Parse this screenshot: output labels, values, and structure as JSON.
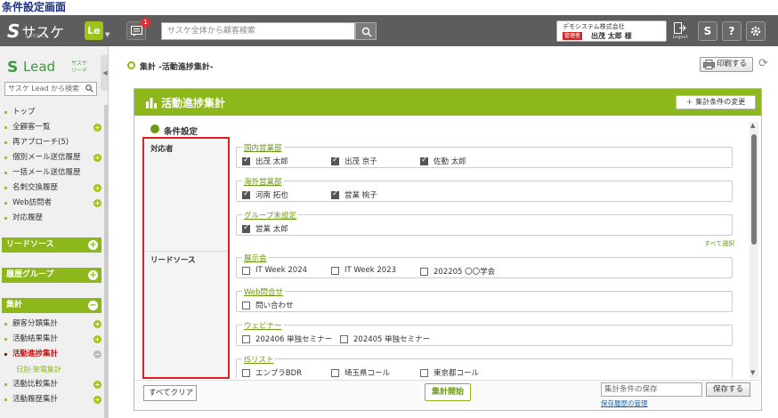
{
  "caption": "条件設定画面",
  "topbar": {
    "logo": "サスケ",
    "logo_sub": "SASUKE",
    "le_badge": "Le",
    "notification_count": "1",
    "search_placeholder": "サスケ全体から顧客検索",
    "company": "デモシステム株式会社",
    "admin_tag": "管理者",
    "user_name": "出茂 太郎 様",
    "logout_label": "Logout",
    "btn_s": "S",
    "btn_help": "?"
  },
  "sidebar": {
    "lead_logo": "Lead",
    "lead_sub": "サスケ\nリード",
    "search_placeholder": "サスケ Lead から検索",
    "items": [
      {
        "label": "トップ",
        "plus": false
      },
      {
        "label": "全顧客一覧",
        "plus": true
      },
      {
        "label": "再アプローチ(5)",
        "plus": false
      },
      {
        "label": "個別メール送信履歴",
        "plus": true
      },
      {
        "label": "一括メール送信履歴",
        "plus": false
      },
      {
        "label": "名刺交換履歴",
        "plus": true
      },
      {
        "label": "Web訪問者",
        "plus": true
      },
      {
        "label": "対応履歴",
        "plus": false
      }
    ],
    "sections": [
      "リードソース",
      "履歴グループ",
      "集計"
    ],
    "agg_items": [
      {
        "label": "顧客分類集計",
        "plus": true
      },
      {
        "label": "活動結果集計",
        "plus": true
      },
      {
        "label": "活動進捗集計",
        "plus": true,
        "active": true
      },
      {
        "label": "日別-架電集計",
        "sub": true
      },
      {
        "label": "活動比較集計",
        "plus": true
      },
      {
        "label": "活動履歴集計",
        "plus": true
      }
    ]
  },
  "breadcrumb": "集計 -活動進捗集計-",
  "print_label": "印刷する",
  "panel": {
    "title": "活動進捗集計",
    "cond_change": "＋ 集計条件の変更",
    "cond_title": "条件設定",
    "row_labels": [
      "対応者",
      "リードソース"
    ],
    "groups": [
      {
        "name": "国内営業部",
        "items": [
          {
            "label": "出茂 太郎",
            "checked": true
          },
          {
            "label": "出茂 京子",
            "checked": true
          },
          {
            "label": "佐勤 太郎",
            "checked": true
          }
        ]
      },
      {
        "name": "海外営業部",
        "items": [
          {
            "label": "河南 拓也",
            "checked": true
          },
          {
            "label": "営業 桃子",
            "checked": true
          }
        ]
      },
      {
        "name": "グループ未設定",
        "items": [
          {
            "label": "営業 太郎",
            "checked": true
          }
        ]
      },
      {
        "name": "展示会",
        "items": [
          {
            "label": "IT Week 2024",
            "checked": false
          },
          {
            "label": "IT Week 2023",
            "checked": false
          },
          {
            "label": "202205 〇〇学会",
            "checked": false
          }
        ]
      },
      {
        "name": "Web問合せ",
        "items": [
          {
            "label": "問い合わせ",
            "checked": false
          }
        ]
      },
      {
        "name": "ウェビナー",
        "items": [
          {
            "label": "202406 単独セミナー",
            "checked": false
          },
          {
            "label": "202405 単独セミナー",
            "checked": false
          }
        ]
      },
      {
        "name": "ISリスト",
        "items": [
          {
            "label": "エンプラBDR",
            "checked": false
          },
          {
            "label": "埼玉県コール",
            "checked": false
          },
          {
            "label": "東京都コール",
            "checked": false
          }
        ]
      }
    ],
    "select_all": "すべて選択",
    "clear_all": "すべてクリア",
    "start": "集計開始",
    "save_placeholder": "集計条件の保存",
    "save_btn": "保存する",
    "history_link": "保存履歴の管理"
  }
}
